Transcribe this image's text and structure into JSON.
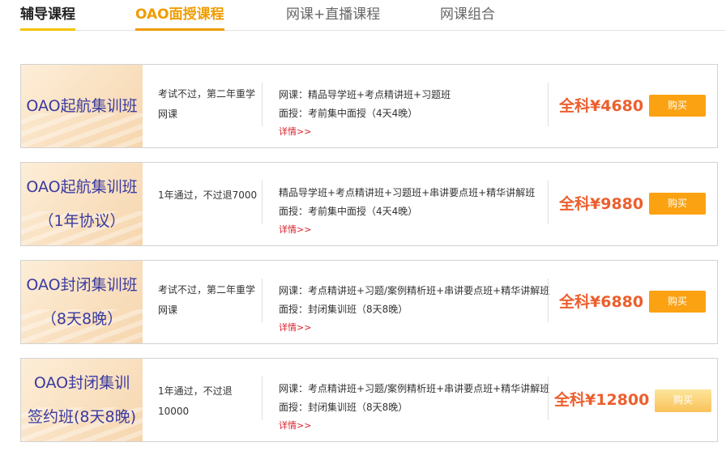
{
  "tabs": [
    {
      "label": "辅导课程"
    },
    {
      "label": "OAO面授课程"
    },
    {
      "label": "网课+直播课程"
    },
    {
      "label": "网课组合"
    }
  ],
  "courses": [
    {
      "image_lines": [
        "OAO起航集训班"
      ],
      "condition": [
        "考试不过，第二年重学",
        "网课"
      ],
      "details": [
        "网课：精品导学班+考点精讲班+习题班",
        "面授：考前集中面授（4天4晚）"
      ],
      "more": "详情>>",
      "price": "全科¥4680",
      "buy": "购买"
    },
    {
      "image_lines": [
        "OAO起航集训班",
        "（1年协议）"
      ],
      "condition": [
        "1年通过，不过退7000"
      ],
      "details": [
        "精品导学班+考点精讲班+习题班+串讲要点班+精华讲解班",
        "面授：考前集中面授（4天4晚）"
      ],
      "more": "详情>>",
      "price": "全科¥9880",
      "buy": "购买"
    },
    {
      "image_lines": [
        "OAO封闭集训班",
        "（8天8晚）"
      ],
      "condition": [
        "考试不过，第二年重学",
        "网课"
      ],
      "details": [
        "网课：考点精讲班+习题/案例精析班+串讲要点班+精华讲解班",
        "面授：封闭集训班（8天8晚）"
      ],
      "more": "详情>>",
      "price": "全科¥6880",
      "buy": "购买"
    },
    {
      "image_lines": [
        "OAO封闭集训",
        "签约班(8天8晚)"
      ],
      "condition": [
        "1年通过，不过退10000"
      ],
      "details": [
        "网课：考点精讲班+习题/案例精析班+串讲要点班+精华讲解班",
        "面授：封闭集训班（8天8晚）"
      ],
      "more": "详情>>",
      "price": "全科¥12800",
      "buy": "购买"
    }
  ],
  "colors": {
    "accent": "#f09c00",
    "price": "#ec5f2e",
    "buy_button": "#fba212",
    "link": "#d8202a",
    "image_text": "#3a3aa0"
  }
}
